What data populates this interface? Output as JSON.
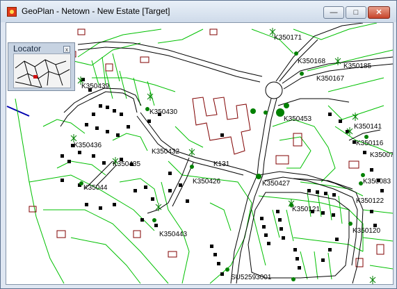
{
  "window": {
    "title": "GeoPlan - Netown - New Estate [Target]",
    "minimize_glyph": "—",
    "maximize_glyph": "□",
    "close_glyph": "✕"
  },
  "locator": {
    "title": "Locator",
    "close_glyph": "x"
  },
  "map": {
    "colors": {
      "parcel": "#00c000",
      "road": "#000000",
      "building_outline": "#800000",
      "node": "#008000",
      "boundary": "#0000b0"
    },
    "labels": {
      "k350171": "K350171",
      "k350168": "K350168",
      "k350185": "K350185",
      "k350167": "K350167",
      "k350439": "K350439",
      "k350430": "K350430",
      "k350453": "K350453",
      "k350141": "K350141",
      "k350436": "K350436",
      "k350116": "K350116",
      "k35007": "K35007",
      "k350432": "K350432",
      "k350435": "K350435",
      "k35044": "K35044",
      "k131": "K131",
      "k350426": "K350426",
      "k350427": "K350427",
      "k350083": "K350083",
      "k350122": "K350122",
      "k350121": "K350121",
      "k350120": "K350120",
      "k350443": "K350443",
      "su52593001": "SU52593001"
    }
  }
}
